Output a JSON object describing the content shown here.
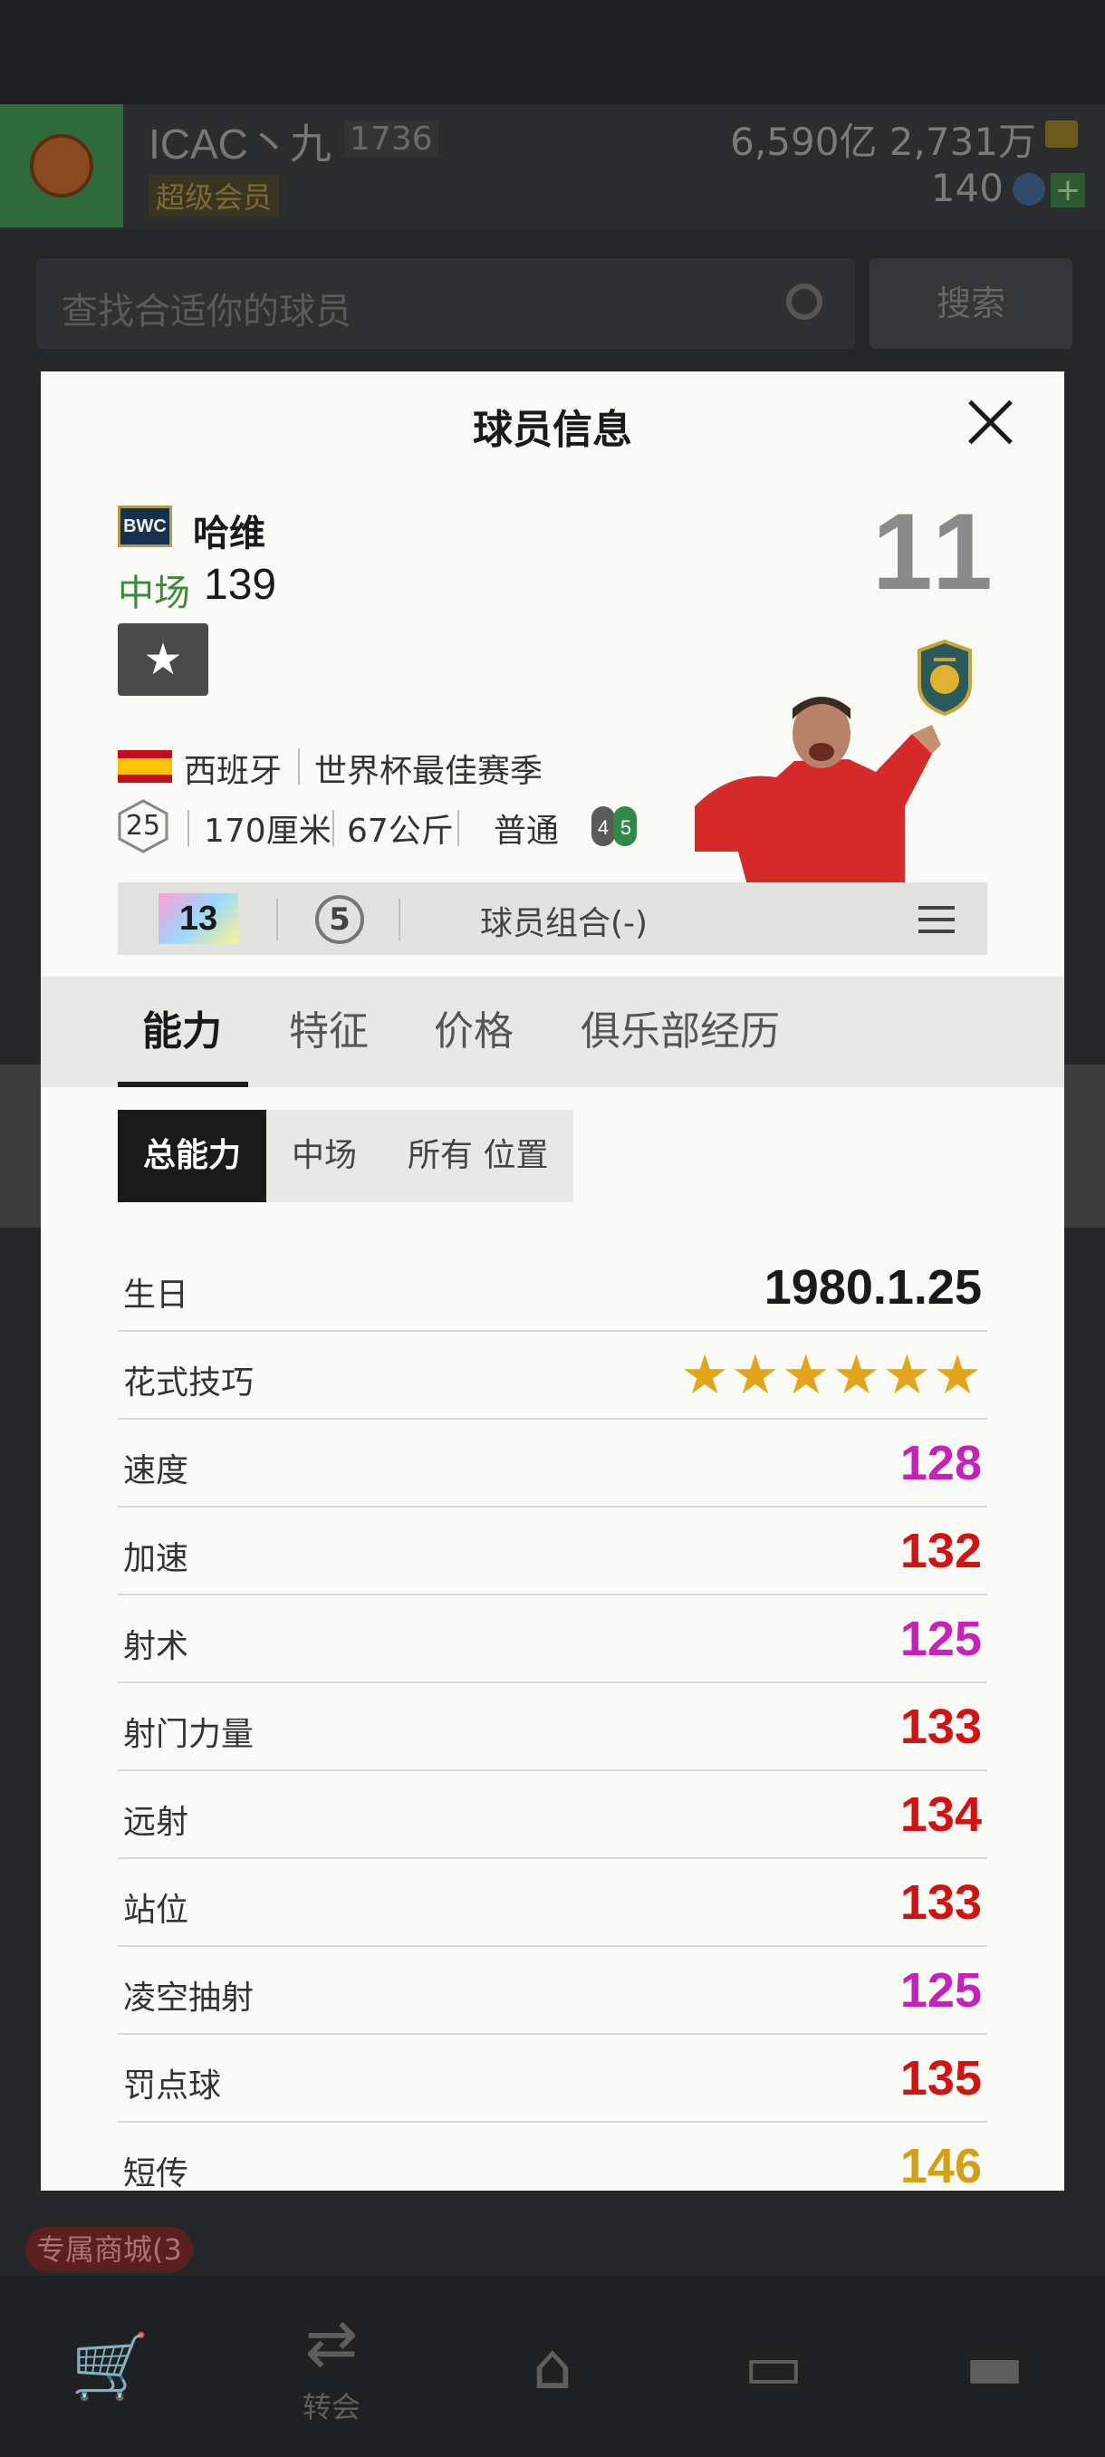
{
  "background": {
    "club_name": "ICAC丶九",
    "club_level": "1736",
    "vip_label": "超级会员",
    "money": "6,590亿 2,731万",
    "coins": "140",
    "search_placeholder": "查找合适你的球员",
    "search_button": "搜索",
    "shop_badge": "专属商城(3",
    "nav": [
      {
        "icon": "cart-icon",
        "label": ""
      },
      {
        "icon": "transfer-icon",
        "label": "转会"
      },
      {
        "icon": "home-icon",
        "label": ""
      },
      {
        "icon": "pitch-icon",
        "label": ""
      },
      {
        "icon": "locker-icon",
        "label": ""
      }
    ]
  },
  "modal": {
    "title": "球员信息",
    "player": {
      "season_badge": "BWC",
      "name": "哈维",
      "position": "中场",
      "overall": "139",
      "jersey_number": "11",
      "nation": "西班牙",
      "season": "世界杯最佳赛季",
      "age": "25",
      "height": "170厘米",
      "weight": "67公斤",
      "body_type": "普通",
      "weak_foot": "4",
      "strong_foot": "5"
    },
    "combo_bar": {
      "enhance_level": "13",
      "grade": "5",
      "combo_label": "球员组合(-)"
    },
    "tabs": [
      "能力",
      "特征",
      "价格",
      "俱乐部经历"
    ],
    "subtabs": [
      "总能力",
      "中场",
      "所有 位置"
    ],
    "stats": [
      {
        "label": "生日",
        "value": "1980.1.25",
        "color": "#1a1a1a"
      },
      {
        "label": "花式技巧",
        "value": "★★★★★★",
        "color": "#e3a51c"
      },
      {
        "label": "速度",
        "value": "128",
        "color": "#c422b8"
      },
      {
        "label": "加速",
        "value": "132",
        "color": "#d01414"
      },
      {
        "label": "射术",
        "value": "125",
        "color": "#c422b8"
      },
      {
        "label": "射门力量",
        "value": "133",
        "color": "#d01414"
      },
      {
        "label": "远射",
        "value": "134",
        "color": "#d01414"
      },
      {
        "label": "站位",
        "value": "133",
        "color": "#d01414"
      },
      {
        "label": "凌空抽射",
        "value": "125",
        "color": "#c422b8"
      },
      {
        "label": "罚点球",
        "value": "135",
        "color": "#d01414"
      },
      {
        "label": "短传",
        "value": "146",
        "color": "#d4a017"
      }
    ]
  }
}
